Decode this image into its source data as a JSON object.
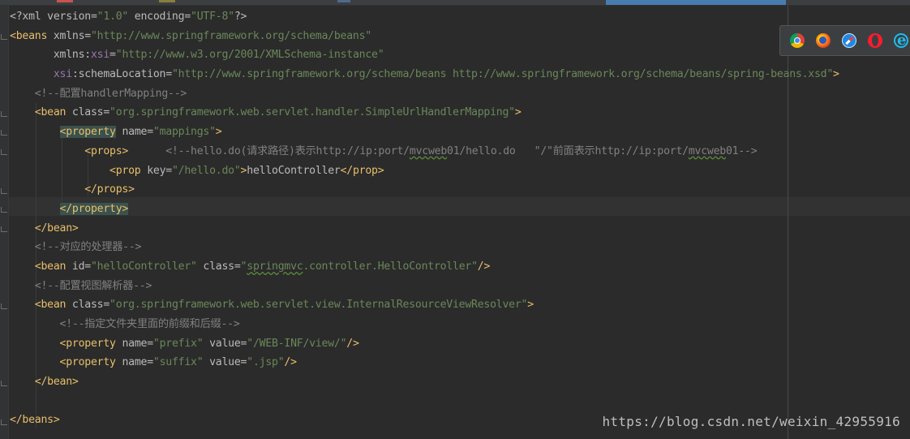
{
  "editor": {
    "lines": [
      {
        "indent": "",
        "segs": [
          {
            "t": "<?xml version=",
            "c": "attr"
          },
          {
            "t": "\"1.0\"",
            "c": "str"
          },
          {
            "t": " encoding=",
            "c": "attr"
          },
          {
            "t": "\"UTF-8\"",
            "c": "str"
          },
          {
            "t": "?>",
            "c": "attr"
          }
        ]
      },
      {
        "indent": "",
        "segs": [
          {
            "t": "<beans ",
            "c": "tag"
          },
          {
            "t": "xmlns=",
            "c": "attr"
          },
          {
            "t": "\"http://www.springframework.org/schema/beans\"",
            "c": "str"
          }
        ]
      },
      {
        "indent": "       ",
        "segs": [
          {
            "t": "xmlns:",
            "c": "attr"
          },
          {
            "t": "xsi",
            "c": "ns"
          },
          {
            "t": "=",
            "c": "attr"
          },
          {
            "t": "\"http://www.w3.org/2001/XMLSchema-instance\"",
            "c": "str"
          }
        ]
      },
      {
        "indent": "       ",
        "segs": [
          {
            "t": "xsi",
            "c": "ns"
          },
          {
            "t": ":schemaLocation=",
            "c": "attr"
          },
          {
            "t": "\"http://www.springframework.org/schema/beans http://www.springframework.org/schema/beans/spring-beans.xsd\"",
            "c": "str"
          },
          {
            "t": ">",
            "c": "tag"
          }
        ]
      },
      {
        "indent": "    ",
        "segs": [
          {
            "t": "<!--配置handlerMapping-->",
            "c": "cmt"
          }
        ]
      },
      {
        "indent": "    ",
        "segs": [
          {
            "t": "<bean ",
            "c": "tag"
          },
          {
            "t": "class=",
            "c": "attr"
          },
          {
            "t": "\"org.springframework.web.servlet.handler.SimpleUrlHandlerMapping\"",
            "c": "str"
          },
          {
            "t": ">",
            "c": "tag"
          }
        ]
      },
      {
        "indent": "        ",
        "segs": [
          {
            "t": "<property",
            "c": "tag hl"
          },
          {
            "t": " name=",
            "c": "attr"
          },
          {
            "t": "\"mappings\"",
            "c": "str"
          },
          {
            "t": ">",
            "c": "tag"
          }
        ]
      },
      {
        "indent": "            ",
        "segs": [
          {
            "t": "<props>",
            "c": "tag"
          },
          {
            "t": "      <!--hello.do(请求路径)表示http://ip:port/",
            "c": "cmt"
          },
          {
            "t": "mvcweb",
            "c": "cmt squig"
          },
          {
            "t": "01/hello.do   \"/\"前面表示http://ip:port/",
            "c": "cmt"
          },
          {
            "t": "mvcweb",
            "c": "cmt squig"
          },
          {
            "t": "01-->",
            "c": "cmt"
          }
        ]
      },
      {
        "indent": "                ",
        "segs": [
          {
            "t": "<prop ",
            "c": "tag"
          },
          {
            "t": "key=",
            "c": "attr"
          },
          {
            "t": "\"/hello.do\"",
            "c": "str"
          },
          {
            "t": ">",
            "c": "tag"
          },
          {
            "t": "helloController",
            "c": "attr"
          },
          {
            "t": "</prop>",
            "c": "tag"
          }
        ]
      },
      {
        "indent": "            ",
        "segs": [
          {
            "t": "</props>",
            "c": "tag"
          }
        ]
      },
      {
        "indent": "        ",
        "segs": [
          {
            "t": "</property>",
            "c": "tag hl"
          }
        ]
      },
      {
        "indent": "    ",
        "segs": [
          {
            "t": "</bean>",
            "c": "tag"
          }
        ]
      },
      {
        "indent": "    ",
        "segs": [
          {
            "t": "<!--对应的处理器-->",
            "c": "cmt"
          }
        ]
      },
      {
        "indent": "    ",
        "segs": [
          {
            "t": "<bean ",
            "c": "tag"
          },
          {
            "t": "id=",
            "c": "attr"
          },
          {
            "t": "\"helloController\"",
            "c": "str"
          },
          {
            "t": " class=",
            "c": "attr"
          },
          {
            "t": "\"",
            "c": "str"
          },
          {
            "t": "springmvc",
            "c": "str squig"
          },
          {
            "t": ".controller.HelloController\"",
            "c": "str"
          },
          {
            "t": "/>",
            "c": "tag"
          }
        ]
      },
      {
        "indent": "    ",
        "segs": [
          {
            "t": "<!--配置视图解析器-->",
            "c": "cmt"
          }
        ]
      },
      {
        "indent": "    ",
        "segs": [
          {
            "t": "<bean ",
            "c": "tag"
          },
          {
            "t": "class=",
            "c": "attr"
          },
          {
            "t": "\"org.springframework.web.servlet.view.InternalResourceViewResolver\"",
            "c": "str"
          },
          {
            "t": ">",
            "c": "tag"
          }
        ]
      },
      {
        "indent": "        ",
        "segs": [
          {
            "t": "<!--指定文件夹里面的前缀和后缀-->",
            "c": "cmt"
          }
        ]
      },
      {
        "indent": "        ",
        "segs": [
          {
            "t": "<property ",
            "c": "tag"
          },
          {
            "t": "name=",
            "c": "attr"
          },
          {
            "t": "\"prefix\"",
            "c": "str"
          },
          {
            "t": " value=",
            "c": "attr"
          },
          {
            "t": "\"/WEB-INF/view/\"",
            "c": "str"
          },
          {
            "t": "/>",
            "c": "tag"
          }
        ]
      },
      {
        "indent": "        ",
        "segs": [
          {
            "t": "<property ",
            "c": "tag"
          },
          {
            "t": "name=",
            "c": "attr"
          },
          {
            "t": "\"suffix\"",
            "c": "str"
          },
          {
            "t": " value=",
            "c": "attr"
          },
          {
            "t": "\".jsp\"",
            "c": "str"
          },
          {
            "t": "/>",
            "c": "tag"
          }
        ]
      },
      {
        "indent": "    ",
        "segs": [
          {
            "t": "</bean>",
            "c": "tag"
          }
        ]
      },
      {
        "indent": "",
        "segs": []
      },
      {
        "indent": "",
        "segs": [
          {
            "t": "</beans>",
            "c": "tag"
          }
        ]
      }
    ]
  },
  "browser_bar": {
    "icons": [
      "chrome-icon",
      "firefox-icon",
      "safari-icon",
      "opera-icon",
      "ie-icon"
    ]
  },
  "watermark": "https://blog.csdn.net/weixin_42955916",
  "colors": {
    "background": "#2b2b2b",
    "tag": "#e8bf6a",
    "attribute": "#bababa",
    "string": "#6a8759",
    "namespace": "#9876aa",
    "comment": "#808080"
  }
}
